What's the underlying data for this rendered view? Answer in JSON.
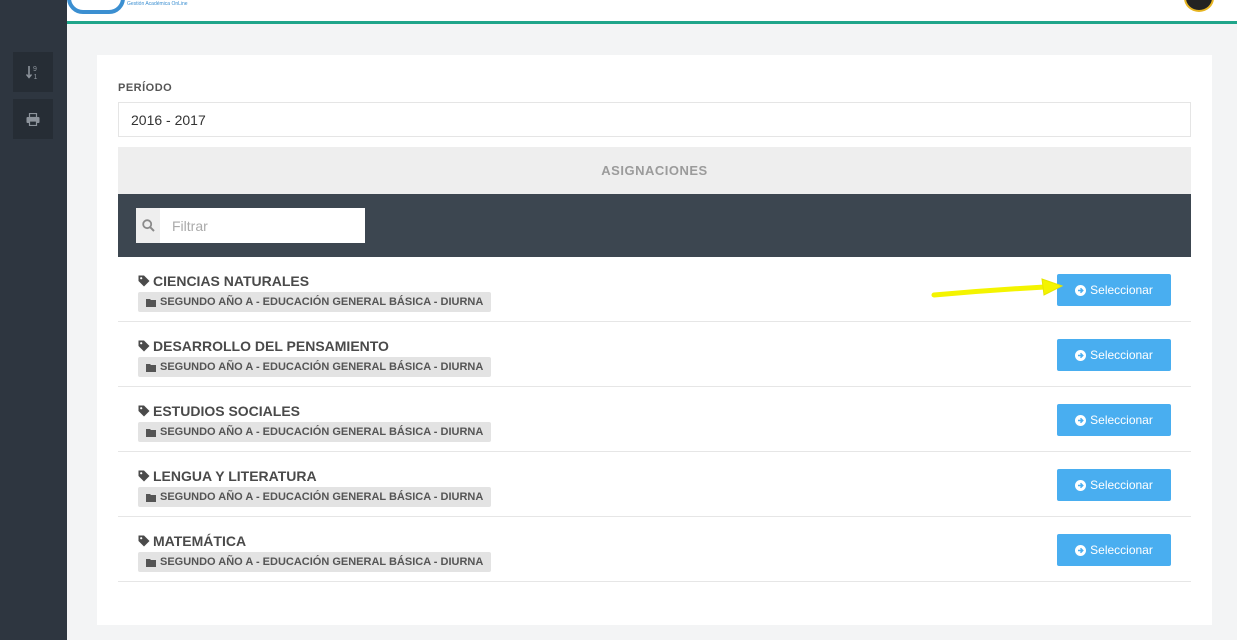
{
  "header": {
    "tagline": "Gestión Académica OnLine"
  },
  "sidebar": {
    "buttons": [
      {
        "icon": "sort-numeric-icon"
      },
      {
        "icon": "print-icon"
      }
    ]
  },
  "period": {
    "label": "PERÍODO",
    "value": "2016 - 2017"
  },
  "assignments": {
    "title": "ASIGNACIONES",
    "filter_placeholder": "Filtrar",
    "select_label": "Seleccionar",
    "items": [
      {
        "subject": "CIENCIAS NATURALES",
        "course": "SEGUNDO AÑO A - EDUCACIÓN GENERAL BÁSICA - DIURNA"
      },
      {
        "subject": "DESARROLLO DEL PENSAMIENTO",
        "course": "SEGUNDO AÑO A - EDUCACIÓN GENERAL BÁSICA - DIURNA"
      },
      {
        "subject": "ESTUDIOS SOCIALES",
        "course": "SEGUNDO AÑO A - EDUCACIÓN GENERAL BÁSICA - DIURNA"
      },
      {
        "subject": "LENGUA Y LITERATURA",
        "course": "SEGUNDO AÑO A - EDUCACIÓN GENERAL BÁSICA - DIURNA"
      },
      {
        "subject": "MATEMÁTICA",
        "course": "SEGUNDO AÑO A - EDUCACIÓN GENERAL BÁSICA - DIURNA"
      }
    ]
  },
  "colors": {
    "accent": "#49aef0",
    "topbar_border": "#1fa58a",
    "sidebar": "#2e3640",
    "filter_bar": "#3c4650",
    "annotation_arrow": "#f4f400"
  }
}
